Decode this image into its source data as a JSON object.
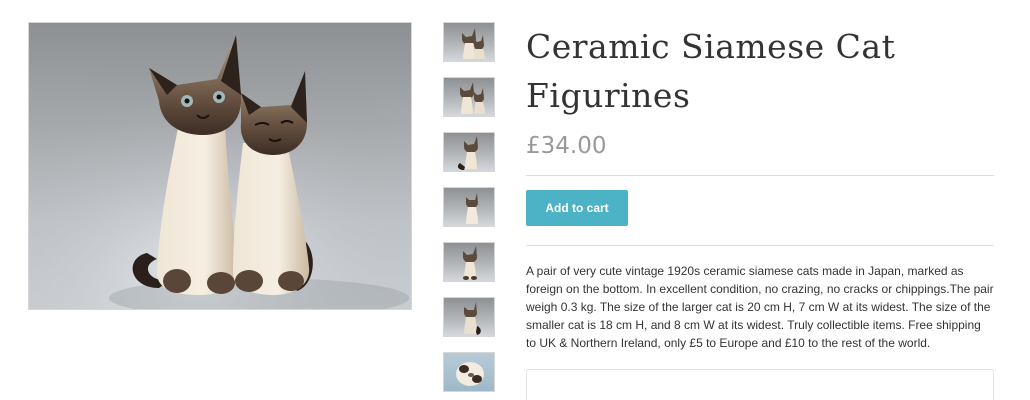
{
  "product": {
    "title": "Ceramic Siamese Cat Figurines",
    "price": "£34.00",
    "add_to_cart_label": "Add to cart",
    "description": "A pair of very cute vintage 1920s ceramic siamese cats made in Japan, marked as foreign on the bottom. In excellent condition, no crazing, no cracks or chippings.The pair weigh 0.3 kg. The size of the larger cat is 20 cm H, 7 cm W at its widest. The size of the smaller cat is 18 cm H, and 8 cm W at its widest. Truly collectible items. Free shipping to UK & Northern Ireland, only £5 to Europe and £10 to the rest of the world."
  },
  "gallery": {
    "main_image": "siamese-cats-photo",
    "thumbnails": [
      "thumbnail-pair-front",
      "thumbnail-pair-angle",
      "thumbnail-single-side",
      "thumbnail-single-profile",
      "thumbnail-single-front",
      "thumbnail-single-back",
      "thumbnail-base-marking"
    ]
  },
  "colors": {
    "accent": "#4bb3c5",
    "title_text": "#333333",
    "price_text": "#999999",
    "divider": "#dddddd"
  }
}
